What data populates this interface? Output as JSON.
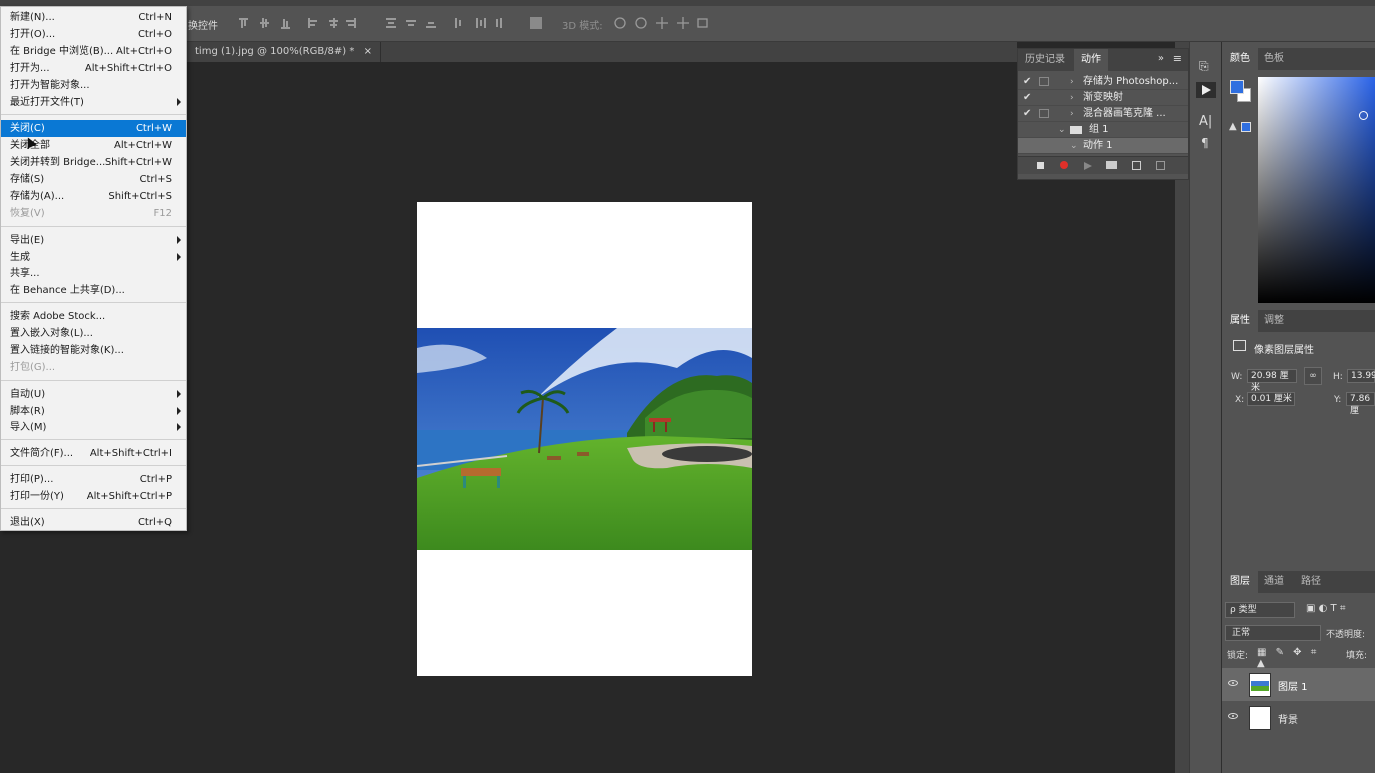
{
  "app": {
    "options_bar": {
      "partial_label": "换控件",
      "mode_3d_label": "3D 模式:"
    },
    "document_tab": {
      "title": "timg (1).jpg @ 100%(RGB/8#) *",
      "close": "×"
    }
  },
  "file_menu": {
    "items": [
      {
        "label": "新建(N)...",
        "shortcut": "Ctrl+N",
        "type": "item"
      },
      {
        "label": "打开(O)...",
        "shortcut": "Ctrl+O",
        "type": "item"
      },
      {
        "label": "在 Bridge 中浏览(B)...",
        "shortcut": "Alt+Ctrl+O",
        "type": "item"
      },
      {
        "label": "打开为...",
        "shortcut": "Alt+Shift+Ctrl+O",
        "type": "item"
      },
      {
        "label": "打开为智能对象...",
        "shortcut": "",
        "type": "item"
      },
      {
        "label": "最近打开文件(T)",
        "shortcut": "",
        "type": "submenu"
      },
      {
        "label": "关闭(C)",
        "shortcut": "Ctrl+W",
        "type": "selected"
      },
      {
        "label": "关闭全部",
        "shortcut": "Alt+Ctrl+W",
        "type": "item"
      },
      {
        "label": "关闭并转到 Bridge...",
        "shortcut": "Shift+Ctrl+W",
        "type": "item"
      },
      {
        "label": "存储(S)",
        "shortcut": "Ctrl+S",
        "type": "item"
      },
      {
        "label": "存储为(A)...",
        "shortcut": "Shift+Ctrl+S",
        "type": "item"
      },
      {
        "label": "恢复(V)",
        "shortcut": "F12",
        "type": "disabled"
      },
      {
        "label": "导出(E)",
        "shortcut": "",
        "type": "submenu"
      },
      {
        "label": "生成",
        "shortcut": "",
        "type": "submenu"
      },
      {
        "label": "共享...",
        "shortcut": "",
        "type": "item"
      },
      {
        "label": "在 Behance 上共享(D)...",
        "shortcut": "",
        "type": "item"
      },
      {
        "label": "搜索 Adobe Stock...",
        "shortcut": "",
        "type": "item"
      },
      {
        "label": "置入嵌入对象(L)...",
        "shortcut": "",
        "type": "item"
      },
      {
        "label": "置入链接的智能对象(K)...",
        "shortcut": "",
        "type": "item"
      },
      {
        "label": "打包(G)...",
        "shortcut": "",
        "type": "disabled"
      },
      {
        "label": "自动(U)",
        "shortcut": "",
        "type": "submenu"
      },
      {
        "label": "脚本(R)",
        "shortcut": "",
        "type": "submenu"
      },
      {
        "label": "导入(M)",
        "shortcut": "",
        "type": "submenu"
      },
      {
        "label": "文件简介(F)...",
        "shortcut": "Alt+Shift+Ctrl+I",
        "type": "item"
      },
      {
        "label": "打印(P)...",
        "shortcut": "Ctrl+P",
        "type": "item"
      },
      {
        "label": "打印一份(Y)",
        "shortcut": "Alt+Shift+Ctrl+P",
        "type": "item"
      },
      {
        "label": "退出(X)",
        "shortcut": "Ctrl+Q",
        "type": "item"
      }
    ]
  },
  "actions_panel": {
    "tabs": [
      "历史记录",
      "动作"
    ],
    "active_tab": "动作",
    "rows": [
      {
        "check": "✔",
        "label": "存储为 Photoshop..."
      },
      {
        "check": "✔",
        "label": "渐变映射"
      },
      {
        "check": "✔",
        "label": "混合器画笔克隆 ..."
      },
      {
        "check": "",
        "label": "组 1"
      },
      {
        "check": "",
        "label": "动作 1"
      }
    ]
  },
  "color_panel": {
    "tabs": [
      "颜色",
      "色板"
    ],
    "foreground": "#2f6fe0",
    "background": "#ffffff"
  },
  "properties_panel": {
    "tabs": [
      "属性",
      "调整"
    ],
    "heading": "像素图层属性",
    "w_label": "W:",
    "w_value": "20.98 厘米",
    "h_label": "H:",
    "h_value": "13.99",
    "x_label": "X:",
    "x_value": "0.01 厘米",
    "y_label": "Y:",
    "y_value": "7.86 厘"
  },
  "layers_panel": {
    "tabs": [
      "图层",
      "通道",
      "路径"
    ],
    "filter_label": "ρ 类型",
    "blend_mode": "正常",
    "opacity_label": "不透明度:",
    "lock_label": "锁定:",
    "fill_label": "填充:",
    "layers": [
      {
        "name": "图层 1"
      },
      {
        "name": "背景"
      }
    ]
  }
}
